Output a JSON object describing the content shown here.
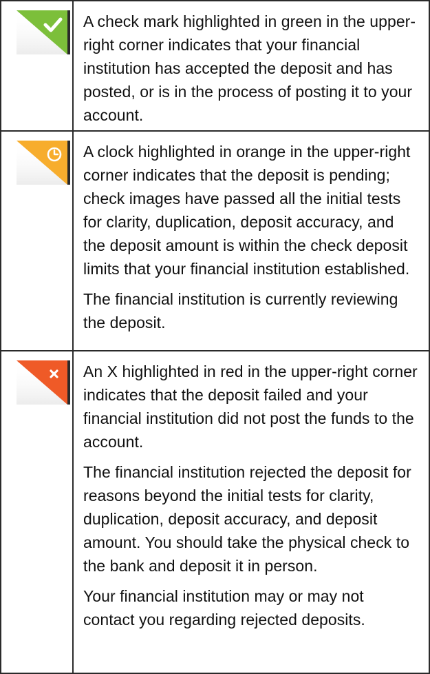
{
  "rows": [
    {
      "icon": "check-mark-icon",
      "color": "#7cbf3a",
      "paragraphs": [
        "A check mark highlighted in green in the upper-right corner indicates that your financial institution has accepted the deposit and has posted, or is in the process of posting it to your account."
      ]
    },
    {
      "icon": "clock-icon",
      "color": "#f7ad2d",
      "paragraphs": [
        "A clock highlighted in orange in the upper-right corner indicates that the deposit is pending; check images have passed all the initial tests for clarity, duplication, deposit accuracy, and the deposit amount is within the check deposit limits that your financial institution established.",
        "The financial institution is currently reviewing the deposit."
      ]
    },
    {
      "icon": "x-icon",
      "color": "#ef5a27",
      "paragraphs": [
        "An X highlighted in red in the upper-right corner indicates that the deposit failed and your financial institution did not post the funds to the account.",
        "The financial institution rejected the deposit for reasons beyond the initial tests for clarity, duplication, deposit accuracy, and deposit amount. You should take the physical check to the bank and deposit it in person.",
        "Your financial institution may or may not contact you regarding rejected deposits."
      ]
    }
  ]
}
